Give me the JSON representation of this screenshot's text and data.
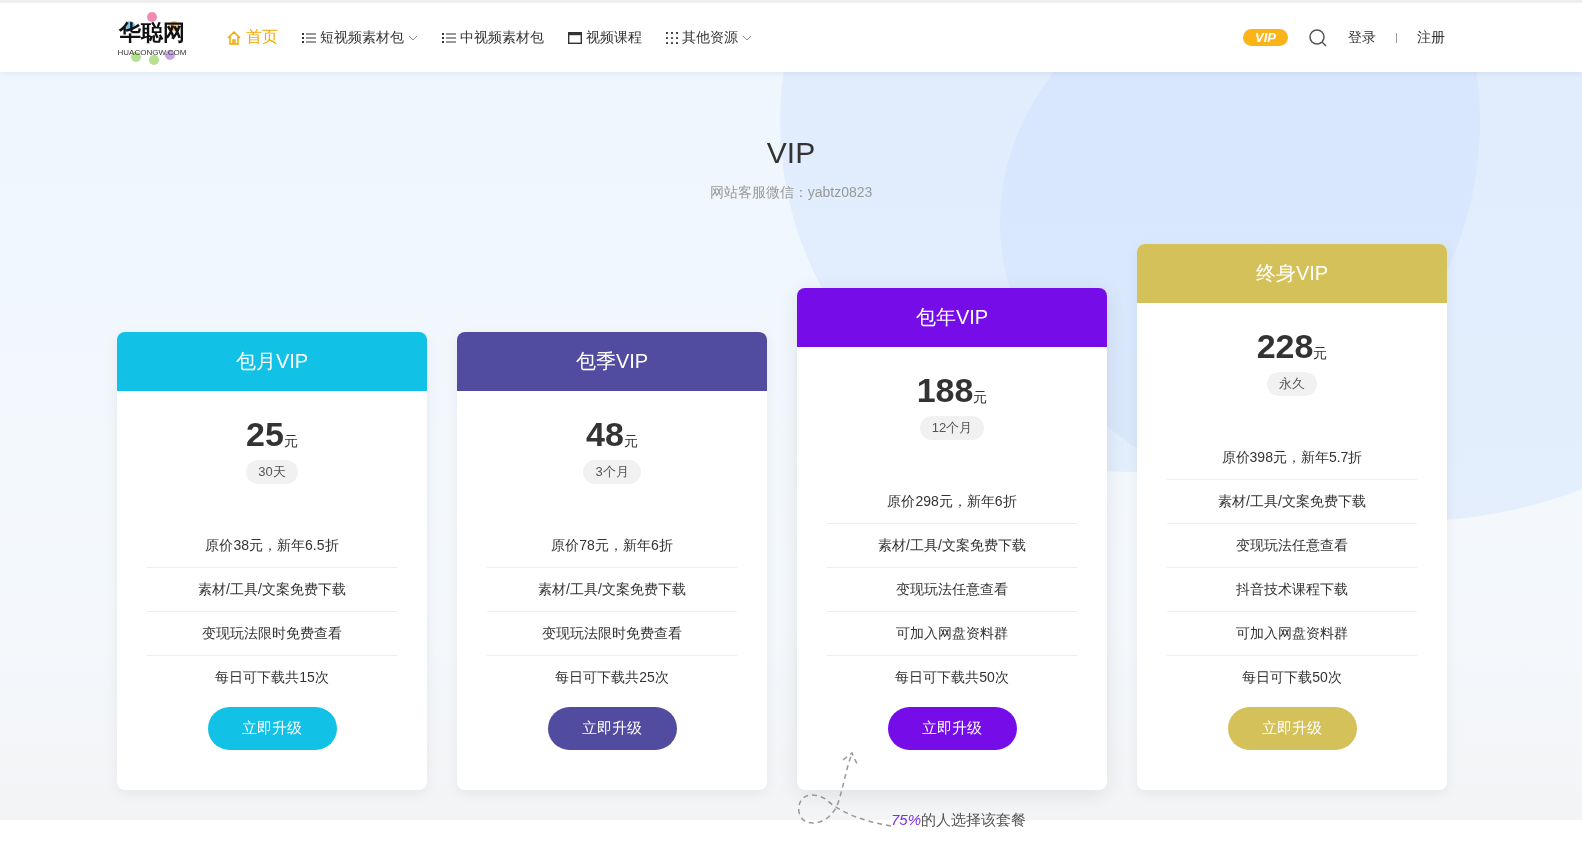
{
  "header": {
    "logo": {
      "text": "华聪网",
      "subtext": "HUACONGW.COM"
    },
    "nav": [
      {
        "label": "首页",
        "kind": "home",
        "selected": true,
        "dropdown": false
      },
      {
        "label": "短视频素材包",
        "kind": "list",
        "selected": false,
        "dropdown": true
      },
      {
        "label": "中视频素材包",
        "kind": "list",
        "selected": false,
        "dropdown": false
      },
      {
        "label": "视频课程",
        "kind": "window",
        "selected": false,
        "dropdown": false
      },
      {
        "label": "其他资源",
        "kind": "grid",
        "selected": false,
        "dropdown": true
      }
    ],
    "vip_badge": "VIP",
    "login": "登录",
    "register": "注册"
  },
  "hero": {
    "title": "VIP",
    "subtitle": "网站客服微信：yabtz0823"
  },
  "plans": [
    {
      "name": "包月VIP",
      "color": "#11c1e6",
      "price": "25",
      "unit": "元",
      "period": "30天",
      "featured": false,
      "features": [
        "原价38元，新年6.5折",
        "素材/工具/文案免费下载",
        "变现玩法限时免费查看",
        "每日可下载共15次"
      ],
      "button": "立即升级"
    },
    {
      "name": "包季VIP",
      "color": "#524ca0",
      "price": "48",
      "unit": "元",
      "period": "3个月",
      "featured": false,
      "features": [
        "原价78元，新年6折",
        "素材/工具/文案免费下载",
        "变现玩法限时免费查看",
        "每日可下载共25次"
      ],
      "button": "立即升级"
    },
    {
      "name": "包年VIP",
      "color": "#760de9",
      "price": "188",
      "unit": "元",
      "period": "12个月",
      "featured": true,
      "features": [
        "原价298元，新年6折",
        "素材/工具/文案免费下载",
        "变现玩法任意查看",
        "可加入网盘资料群",
        "每日可下载共50次"
      ],
      "button": "立即升级"
    },
    {
      "name": "终身VIP",
      "color": "#d4c15a",
      "price": "228",
      "unit": "元",
      "period": "永久",
      "featured": false,
      "features": [
        "原价398元，新年5.7折",
        "素材/工具/文案免费下载",
        "变现玩法任意查看",
        "抖音技术课程下载",
        "可加入网盘资料群",
        "每日可下载50次"
      ],
      "button": "立即升级"
    }
  ],
  "note": {
    "percent": "75%",
    "text": "的人选择该套餐"
  }
}
